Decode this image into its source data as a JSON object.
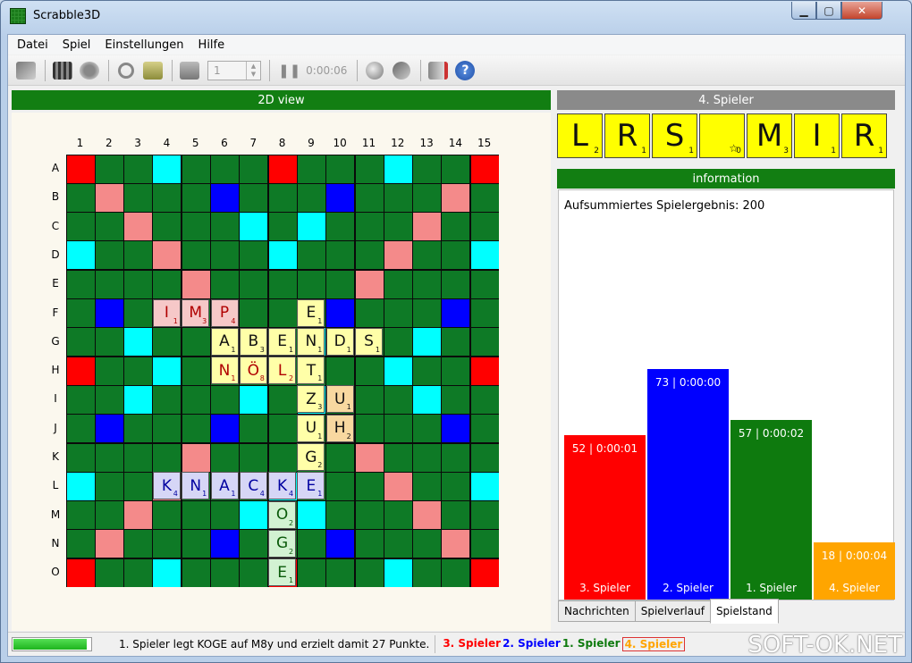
{
  "window": {
    "title": "Scrabble3D"
  },
  "menu": [
    "Datei",
    "Spiel",
    "Einstellungen",
    "Hilfe"
  ],
  "toolbar": {
    "spin_value": "1",
    "timer": "0:00:06"
  },
  "board_panel": {
    "title": "2D view"
  },
  "columns": [
    "1",
    "2",
    "3",
    "4",
    "5",
    "6",
    "7",
    "8",
    "9",
    "10",
    "11",
    "12",
    "13",
    "14",
    "15"
  ],
  "rows": [
    "A",
    "B",
    "C",
    "D",
    "E",
    "F",
    "G",
    "H",
    "I",
    "J",
    "K",
    "L",
    "M",
    "N",
    "O"
  ],
  "colors": {
    "tw": "#ff0000",
    "dw": "#f48a8a",
    "tl": "#0000ff",
    "dl": "#00ffff",
    "board": "#0e7a26",
    "player1": "#0e7a0e",
    "player2": "#0000ff",
    "player3": "#ff0000",
    "player4": "#ffa500"
  },
  "premium": {
    "tw": [
      [
        0,
        0
      ],
      [
        0,
        7
      ],
      [
        0,
        14
      ],
      [
        7,
        0
      ],
      [
        7,
        14
      ],
      [
        14,
        0
      ],
      [
        14,
        7
      ],
      [
        14,
        14
      ]
    ],
    "dw": [
      [
        1,
        1
      ],
      [
        2,
        2
      ],
      [
        3,
        3
      ],
      [
        4,
        4
      ],
      [
        1,
        13
      ],
      [
        2,
        12
      ],
      [
        3,
        11
      ],
      [
        4,
        10
      ],
      [
        10,
        4
      ],
      [
        11,
        3
      ],
      [
        12,
        2
      ],
      [
        13,
        1
      ],
      [
        10,
        10
      ],
      [
        11,
        11
      ],
      [
        12,
        12
      ],
      [
        13,
        13
      ]
    ],
    "tl": [
      [
        1,
        5
      ],
      [
        1,
        9
      ],
      [
        5,
        1
      ],
      [
        5,
        5
      ],
      [
        5,
        9
      ],
      [
        5,
        13
      ],
      [
        9,
        1
      ],
      [
        9,
        5
      ],
      [
        9,
        9
      ],
      [
        9,
        13
      ],
      [
        13,
        5
      ],
      [
        13,
        9
      ]
    ],
    "dl": [
      [
        0,
        3
      ],
      [
        0,
        11
      ],
      [
        2,
        6
      ],
      [
        2,
        8
      ],
      [
        3,
        0
      ],
      [
        3,
        7
      ],
      [
        3,
        14
      ],
      [
        6,
        2
      ],
      [
        6,
        6
      ],
      [
        6,
        8
      ],
      [
        6,
        12
      ],
      [
        7,
        3
      ],
      [
        7,
        11
      ],
      [
        8,
        2
      ],
      [
        8,
        6
      ],
      [
        8,
        8
      ],
      [
        8,
        12
      ],
      [
        11,
        0
      ],
      [
        11,
        7
      ],
      [
        11,
        14
      ],
      [
        12,
        6
      ],
      [
        12,
        8
      ],
      [
        14,
        3
      ],
      [
        14,
        11
      ]
    ]
  },
  "tiles": [
    {
      "r": 5,
      "c": 3,
      "l": "I",
      "p": "1",
      "bg": "#f6c8c8",
      "fg": "#b00000"
    },
    {
      "r": 5,
      "c": 4,
      "l": "M",
      "p": "3",
      "bg": "#f6c8c8",
      "fg": "#b00000"
    },
    {
      "r": 5,
      "c": 5,
      "l": "P",
      "p": "4",
      "bg": "#f6c8c8",
      "fg": "#b00000"
    },
    {
      "r": 5,
      "c": 8,
      "l": "E",
      "p": "1",
      "bg": "#ffffa8",
      "fg": "#111"
    },
    {
      "r": 6,
      "c": 5,
      "l": "A",
      "p": "1",
      "bg": "#ffffa8",
      "fg": "#111"
    },
    {
      "r": 6,
      "c": 6,
      "l": "B",
      "p": "3",
      "bg": "#ffffa8",
      "fg": "#111"
    },
    {
      "r": 6,
      "c": 7,
      "l": "E",
      "p": "1",
      "bg": "#ffffa8",
      "fg": "#111"
    },
    {
      "r": 6,
      "c": 8,
      "l": "N",
      "p": "1",
      "bg": "#ffffa8",
      "fg": "#111"
    },
    {
      "r": 6,
      "c": 9,
      "l": "D",
      "p": "1",
      "bg": "#ffffa8",
      "fg": "#111"
    },
    {
      "r": 6,
      "c": 10,
      "l": "S",
      "p": "1",
      "bg": "#ffffa8",
      "fg": "#111"
    },
    {
      "r": 7,
      "c": 5,
      "l": "N",
      "p": "1",
      "bg": "#ffffa8",
      "fg": "#b00000"
    },
    {
      "r": 7,
      "c": 6,
      "l": "Ö",
      "p": "8",
      "bg": "#ffffa8",
      "fg": "#b00000"
    },
    {
      "r": 7,
      "c": 7,
      "l": "L",
      "p": "2",
      "bg": "#ffffa8",
      "fg": "#b00000"
    },
    {
      "r": 7,
      "c": 8,
      "l": "T",
      "p": "1",
      "bg": "#ffffa8",
      "fg": "#111"
    },
    {
      "r": 8,
      "c": 8,
      "l": "Z",
      "p": "3",
      "bg": "#ffffa8",
      "fg": "#111"
    },
    {
      "r": 8,
      "c": 9,
      "l": "U",
      "p": "1",
      "bg": "#f8d8a0",
      "fg": "#111"
    },
    {
      "r": 9,
      "c": 8,
      "l": "U",
      "p": "1",
      "bg": "#ffffa8",
      "fg": "#111"
    },
    {
      "r": 9,
      "c": 9,
      "l": "H",
      "p": "2",
      "bg": "#f8d8a0",
      "fg": "#111"
    },
    {
      "r": 10,
      "c": 8,
      "l": "G",
      "p": "2",
      "bg": "#ffffa8",
      "fg": "#111"
    },
    {
      "r": 11,
      "c": 3,
      "l": "K",
      "p": "4",
      "bg": "#d6d6f6",
      "fg": "#0000a0"
    },
    {
      "r": 11,
      "c": 4,
      "l": "N",
      "p": "1",
      "bg": "#d6d6f6",
      "fg": "#0000a0"
    },
    {
      "r": 11,
      "c": 5,
      "l": "A",
      "p": "1",
      "bg": "#d6d6f6",
      "fg": "#0000a0"
    },
    {
      "r": 11,
      "c": 6,
      "l": "C",
      "p": "4",
      "bg": "#d6d6f6",
      "fg": "#0000a0"
    },
    {
      "r": 11,
      "c": 7,
      "l": "K",
      "p": "4",
      "bg": "#d6d6f6",
      "fg": "#0000a0"
    },
    {
      "r": 11,
      "c": 8,
      "l": "E",
      "p": "1",
      "bg": "#d6d6f6",
      "fg": "#0000a0"
    },
    {
      "r": 12,
      "c": 7,
      "l": "O",
      "p": "2",
      "bg": "#d2f2d2",
      "fg": "#0a5a0a"
    },
    {
      "r": 13,
      "c": 7,
      "l": "G",
      "p": "2",
      "bg": "#d2f2d2",
      "fg": "#0a5a0a"
    },
    {
      "r": 14,
      "c": 7,
      "l": "E",
      "p": "1",
      "bg": "#d2f2d2",
      "fg": "#0a5a0a"
    }
  ],
  "right": {
    "player_title": "4. Spieler",
    "info_title": "information",
    "score_label": "Aufsummiertes Spielergebnis: 200"
  },
  "rack": [
    {
      "l": "L",
      "p": "2"
    },
    {
      "l": "R",
      "p": "1"
    },
    {
      "l": "S",
      "p": "1"
    },
    {
      "l": "",
      "p": "0"
    },
    {
      "l": "M",
      "p": "3"
    },
    {
      "l": "I",
      "p": "1"
    },
    {
      "l": "R",
      "p": "1"
    }
  ],
  "chart_data": {
    "type": "bar",
    "categories": [
      "3. Spieler",
      "2. Spieler",
      "1. Spieler",
      "4. Spieler"
    ],
    "values": [
      52,
      73,
      57,
      18
    ],
    "labels": [
      "52 | 0:00:01",
      "73 | 0:00:00",
      "57 | 0:00:02",
      "18 | 0:00:04"
    ],
    "colors": [
      "#ff0000",
      "#0000ff",
      "#0e7a0e",
      "#ffa500"
    ],
    "ylim": [
      0,
      73
    ]
  },
  "tabs": [
    "Nachrichten",
    "Spielverlauf",
    "Spielstand"
  ],
  "status": {
    "progress": 0.95,
    "message": "1. Spieler legt KOGE auf M8y und erzielt damit 27 Punkte.",
    "players": [
      "3. Spieler",
      "2. Spieler",
      "1. Spieler",
      "4. Spieler"
    ],
    "watermark": "SOFT-OK.NET"
  }
}
